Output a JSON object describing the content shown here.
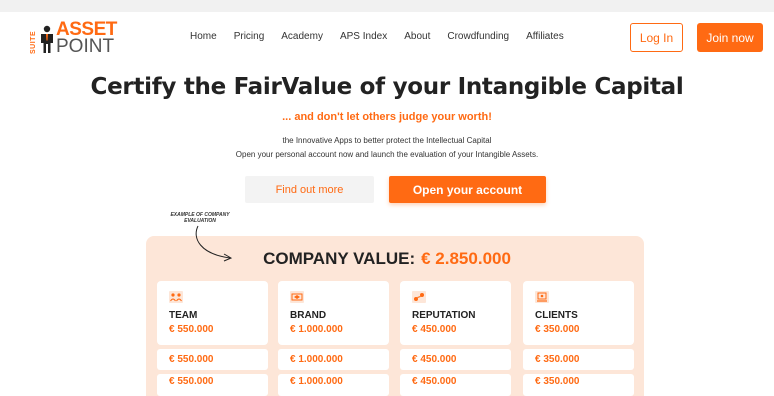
{
  "logo": {
    "suite": "SUITE",
    "asset": "ASSET",
    "point": "POINT"
  },
  "nav": {
    "items": [
      "Home",
      "Pricing",
      "Academy",
      "APS Index",
      "About",
      "Crowdfunding",
      "Affiliates"
    ]
  },
  "auth": {
    "login_label": "Log In",
    "join_label": "Join now"
  },
  "hero": {
    "title": "Certify the FairValue of your Intangible Capital",
    "subtitle": "... and don't let others judge your worth!",
    "desc_line1": "the Innovative Apps to better protect the Intellectual Capital",
    "desc_line2": "Open your personal account now and launch the evaluation of your Intangible Assets.",
    "find_label": "Find out more",
    "open_label": "Open your account"
  },
  "evaluation": {
    "note": "EXAMPLE OF COMPANY EVALUATION",
    "label": "COMPANY VALUE:",
    "amount": "€ 2.850.000",
    "cards": [
      {
        "title": "TEAM",
        "value": "€ 550.000",
        "icon": "team-icon"
      },
      {
        "title": "BRAND",
        "value": "€ 1.000.000",
        "icon": "brand-icon"
      },
      {
        "title": "REPUTATION",
        "value": "€ 450.000",
        "icon": "reputation-icon"
      },
      {
        "title": "CLIENTS",
        "value": "€ 350.000",
        "icon": "clients-icon"
      }
    ],
    "rows": [
      [
        "€ 550.000",
        "€ 1.000.000",
        "€ 450.000",
        "€ 350.000"
      ],
      [
        "€ 550.000",
        "€ 1.000.000",
        "€ 450.000",
        "€ 350.000"
      ]
    ]
  },
  "colors": {
    "accent": "#ff6a13",
    "panel": "#fde6d8",
    "text": "#222222"
  }
}
